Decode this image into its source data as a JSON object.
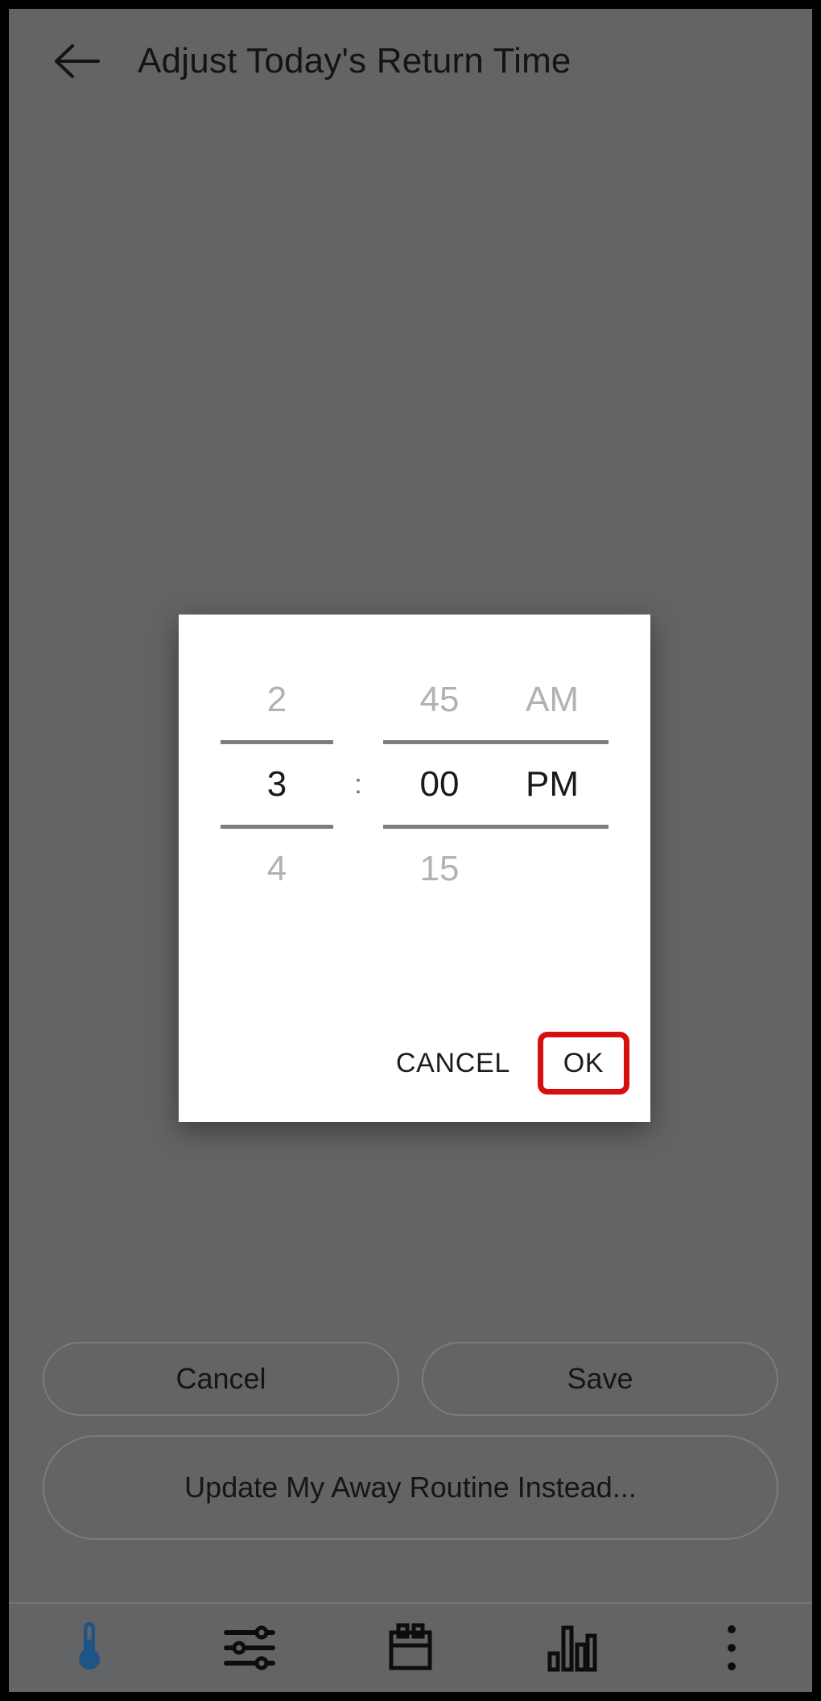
{
  "header": {
    "back_icon": "arrow-left-icon",
    "title": "Adjust Today's Return Time"
  },
  "dialog": {
    "picker": {
      "hour": {
        "prev": "2",
        "selected": "3",
        "next": "4"
      },
      "separator": ":",
      "minute": {
        "prev": "45",
        "selected": "00",
        "next": "15"
      },
      "meridiem": {
        "prev": "AM",
        "selected": "PM",
        "next": ""
      }
    },
    "cancel_label": "CANCEL",
    "ok_label": "OK",
    "highlight_color": "#d80f0f"
  },
  "actions": {
    "cancel_label": "Cancel",
    "save_label": "Save",
    "update_routine_label": "Update My Away Routine Instead..."
  },
  "navbar": {
    "items": [
      {
        "icon": "thermometer-icon",
        "color": "#1f5585",
        "active": true
      },
      {
        "icon": "sliders-icon",
        "color": "#0d0d0d",
        "active": false
      },
      {
        "icon": "calendar-icon",
        "color": "#0d0d0d",
        "active": false
      },
      {
        "icon": "bar-chart-icon",
        "color": "#0d0d0d",
        "active": false
      },
      {
        "icon": "overflow-menu-icon",
        "color": "#0d0d0d",
        "active": false
      }
    ]
  },
  "colors": {
    "background": "#636466",
    "dialog_background": "#ffffff",
    "accent_red": "#d80f0f",
    "thermometer_blue": "#1f5585"
  }
}
